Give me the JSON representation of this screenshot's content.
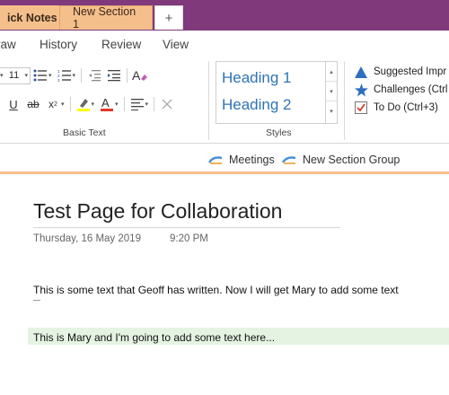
{
  "ribbon_tabs": [
    "raw",
    "History",
    "Review",
    "View"
  ],
  "ribbon": {
    "font_size": "11",
    "group_basic_text": "Basic Text",
    "group_styles": "Styles",
    "styles": [
      "Heading 1",
      "Heading 2"
    ],
    "tags": [
      {
        "label": "Suggested Impr",
        "icon": "triangle-icon"
      },
      {
        "label": "Challenges (Ctrl",
        "icon": "star-icon"
      },
      {
        "label": "To Do (Ctrl+3)",
        "icon": "checkbox-icon"
      }
    ]
  },
  "sections": {
    "quick_notes": "ick Notes",
    "active": "New Section 1",
    "add": "+",
    "links": [
      "Meetings",
      "New Section Group"
    ]
  },
  "page": {
    "title": "Test Page for Collaboration",
    "date": "Thursday, 16 May 2019",
    "time": "9:20 PM",
    "note1": "This is some text that Geoff has written. Now I will get Mary to add some text",
    "note2": "This is Mary and I'm going to add some text here..."
  },
  "colors": {
    "title_bar": "#80397b",
    "section_tab": "#f5bf8c",
    "heading_blue": "#2e74b5",
    "highlight_green": "#e5f3e3"
  }
}
